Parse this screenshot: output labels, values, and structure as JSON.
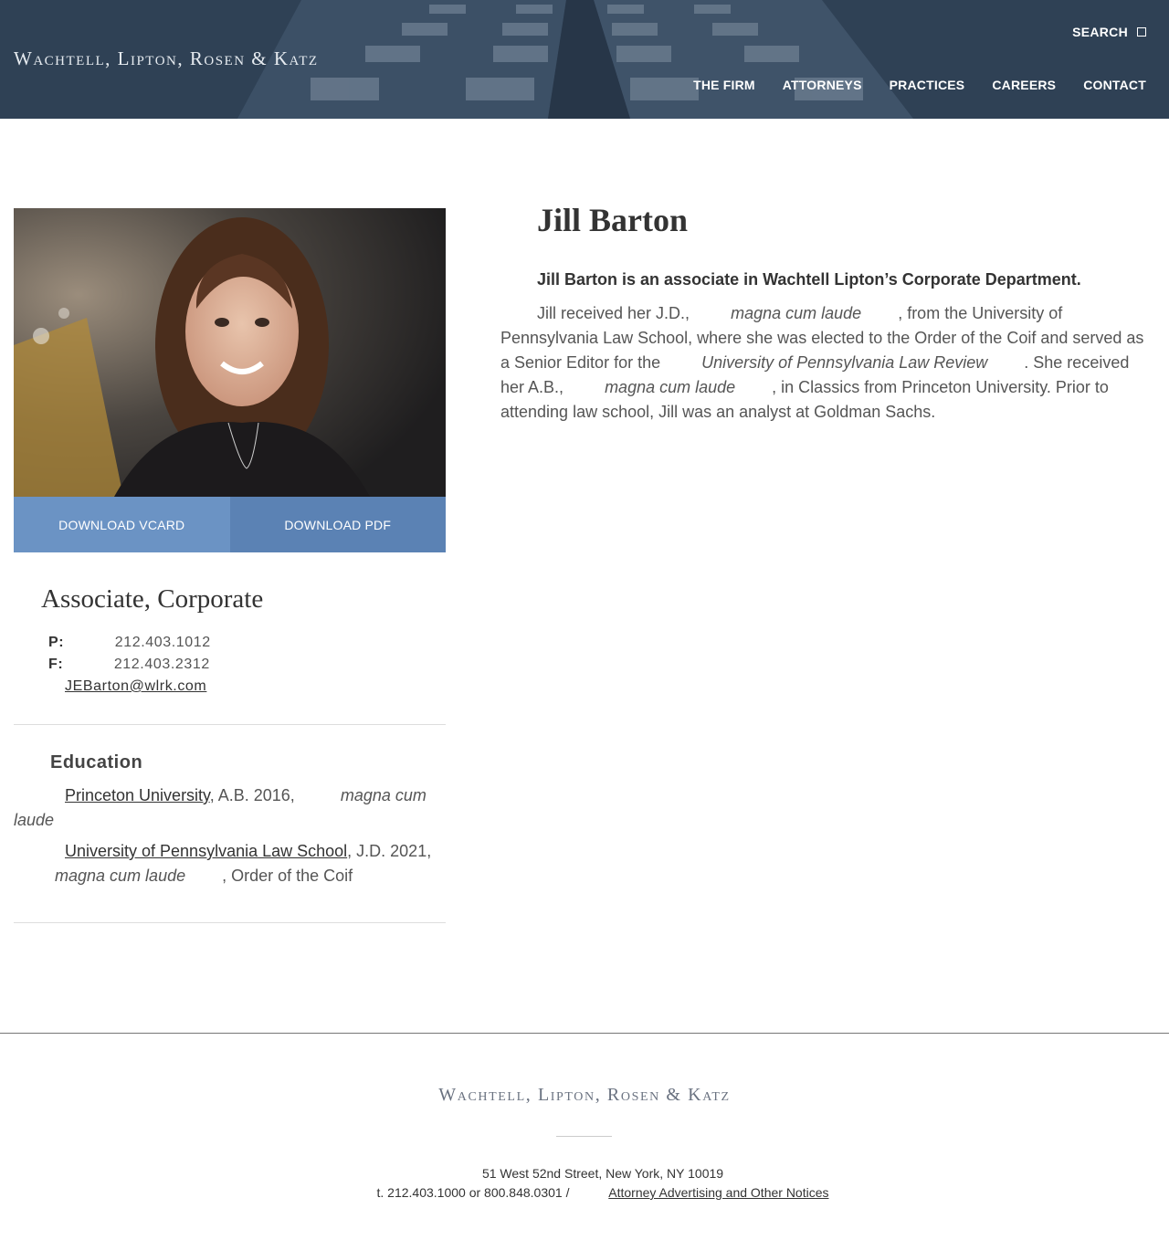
{
  "header": {
    "logo": "Wachtell, Lipton, Rosen & Katz",
    "search_label": "SEARCH",
    "nav": [
      "THE FIRM",
      "ATTORNEYS",
      "PRACTICES",
      "CAREERS",
      "CONTACT"
    ]
  },
  "profile": {
    "name": "Jill Barton",
    "download_vcard": "DOWNLOAD VCARD",
    "download_pdf": "DOWNLOAD PDF",
    "role": "Associate, Corporate",
    "phone_label": "P:",
    "phone": "212.403.1012",
    "fax_label": "F:",
    "fax": "212.403.2312",
    "email": "JEBarton@wlrk.com"
  },
  "education": {
    "heading": "Education",
    "entries": [
      {
        "school": "Princeton University",
        "detail": ", A.B. 2016, ",
        "honor": "magna cum laude",
        "tail": ""
      },
      {
        "school": "University of Pennsylvania Law School",
        "detail": ", J.D. 2021, ",
        "honor": "magna cum laude",
        "tail": ", Order of the Coif"
      }
    ]
  },
  "bio": {
    "lead": "Jill Barton is an associate in Wachtell Lipton’s Corporate Department.",
    "p1": "Jill received her J.D., ",
    "h1": "magna cum laude",
    "p2": ", from the University of Pennsylvania Law School, where she was elected to the Order of the Coif and served as a Senior Editor for the ",
    "h2": "University of Pennsylvania Law Review",
    "p3": ". She received her A.B., ",
    "h3": "magna cum laude",
    "p4": ", in Classics from Princeton University. Prior to attending law school, Jill was an analyst at Goldman Sachs."
  },
  "footer": {
    "logo": "Wachtell, Lipton, Rosen & Katz",
    "address": "51 West 52nd Street, New York, NY 10019",
    "phone": "t. 212.403.1000 or 800.848.0301 / ",
    "notices_link": "Attorney Advertising and Other Notices"
  }
}
